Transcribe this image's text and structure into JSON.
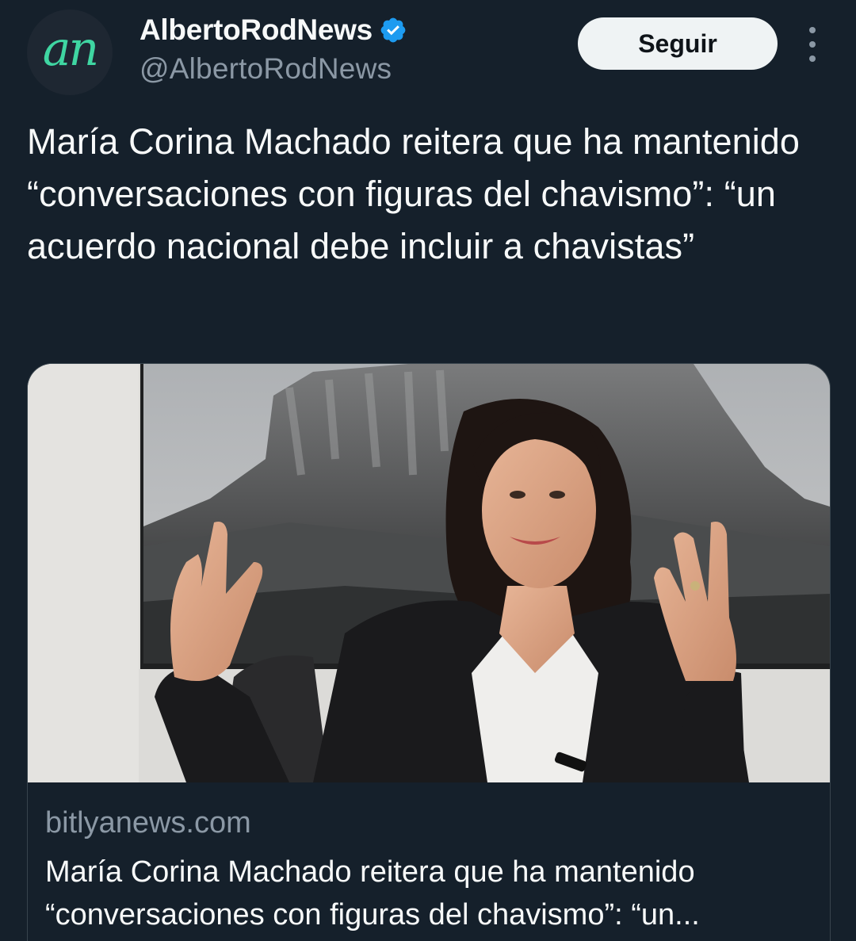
{
  "author": {
    "avatar_icon": "an-logo-icon",
    "avatar_text": "an",
    "display_name": "AlbertoRodNews",
    "handle": "@AlbertoRodNews",
    "verified_icon": "verified-badge-icon",
    "accent_color": "#1d9bf0"
  },
  "actions": {
    "follow_label": "Seguir",
    "more_icon": "more-vertical-icon"
  },
  "tweet": {
    "text": "María Corina Machado reitera que ha mantenido “conversaciones con figuras del chavismo”: “un acuerdo nacional debe incluir a chavistas”"
  },
  "link_card": {
    "domain": "bitlyanews.com",
    "title": "María Corina Machado reitera que ha mantenido “conversaciones con figuras del chavismo”: “un..."
  },
  "colors": {
    "background": "#15202b",
    "text_primary": "#f7f9f9",
    "text_secondary": "#8b98a5",
    "button_bg": "#eff3f4",
    "border": "#38444d",
    "avatar_mark": "#3fd6a2"
  }
}
